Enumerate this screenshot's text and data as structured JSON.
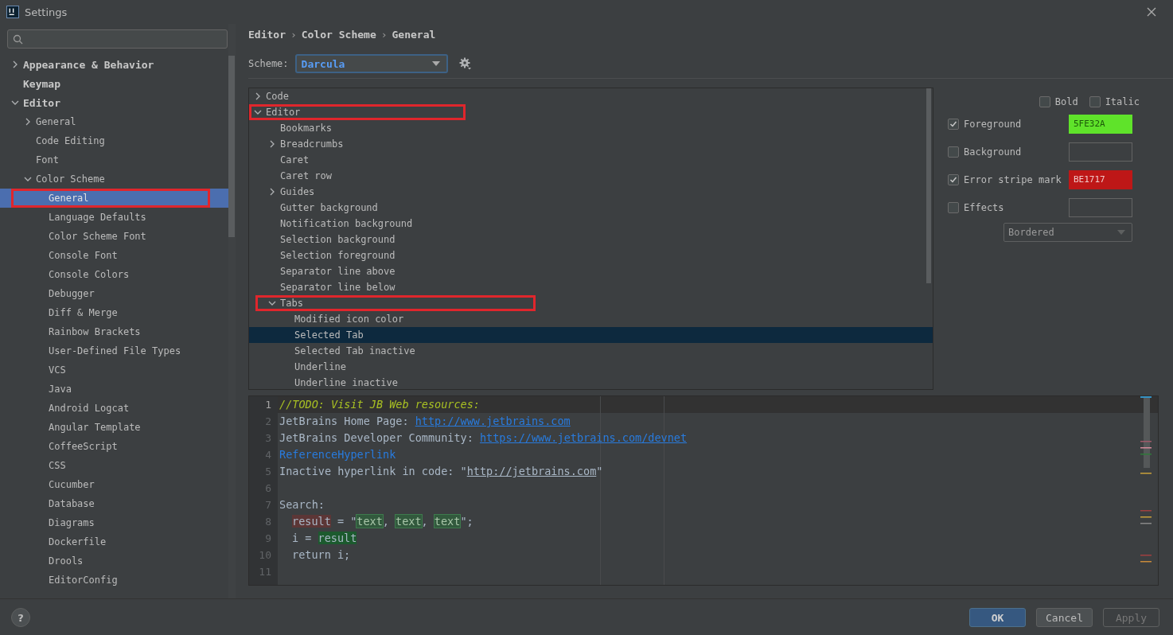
{
  "window": {
    "title": "Settings"
  },
  "sidebar": {
    "items": [
      {
        "label": "Appearance & Behavior",
        "expanded": false,
        "selected": false
      },
      {
        "label": "Keymap",
        "selected": false
      },
      {
        "label": "Editor",
        "expanded": true,
        "selected": false,
        "children": [
          {
            "label": "General",
            "expanded": false,
            "selected": false
          },
          {
            "label": "Code Editing",
            "selected": false
          },
          {
            "label": "Font",
            "selected": false
          },
          {
            "label": "Color Scheme",
            "expanded": true,
            "selected": false,
            "children": [
              {
                "label": "General",
                "selected": true,
                "annotated": true
              },
              {
                "label": "Language Defaults",
                "selected": false
              },
              {
                "label": "Color Scheme Font",
                "selected": false
              },
              {
                "label": "Console Font",
                "selected": false
              },
              {
                "label": "Console Colors",
                "selected": false
              },
              {
                "label": "Debugger",
                "selected": false
              },
              {
                "label": "Diff & Merge",
                "selected": false
              },
              {
                "label": "Rainbow Brackets",
                "selected": false
              },
              {
                "label": "User-Defined File Types",
                "selected": false
              },
              {
                "label": "VCS",
                "selected": false
              },
              {
                "label": "Java",
                "selected": false
              },
              {
                "label": "Android Logcat",
                "selected": false
              },
              {
                "label": "Angular Template",
                "selected": false
              },
              {
                "label": "CoffeeScript",
                "selected": false
              },
              {
                "label": "CSS",
                "selected": false
              },
              {
                "label": "Cucumber",
                "selected": false
              },
              {
                "label": "Database",
                "selected": false
              },
              {
                "label": "Diagrams",
                "selected": false
              },
              {
                "label": "Dockerfile",
                "selected": false
              },
              {
                "label": "Drools",
                "selected": false
              },
              {
                "label": "EditorConfig",
                "selected": false
              }
            ]
          }
        ]
      }
    ]
  },
  "breadcrumb": {
    "separator": "›",
    "items": [
      "Editor",
      "Color Scheme",
      "General"
    ]
  },
  "scheme": {
    "label": "Scheme:",
    "value": "Darcula"
  },
  "attributes": [
    {
      "label": "Code",
      "expanded": false,
      "selected": false
    },
    {
      "label": "Editor",
      "expanded": true,
      "selected": false,
      "annotated": true,
      "children": [
        {
          "label": "Bookmarks",
          "selected": false
        },
        {
          "label": "Breadcrumbs",
          "expanded": false,
          "selected": false
        },
        {
          "label": "Caret",
          "selected": false
        },
        {
          "label": "Caret row",
          "selected": false
        },
        {
          "label": "Guides",
          "expanded": false,
          "selected": false
        },
        {
          "label": "Gutter background",
          "selected": false
        },
        {
          "label": "Notification background",
          "selected": false
        },
        {
          "label": "Selection background",
          "selected": false
        },
        {
          "label": "Selection foreground",
          "selected": false
        },
        {
          "label": "Separator line above",
          "selected": false
        },
        {
          "label": "Separator line below",
          "selected": false
        },
        {
          "label": "Tabs",
          "expanded": true,
          "selected": false,
          "annotated": true,
          "children": [
            {
              "label": "Modified icon color",
              "selected": false
            },
            {
              "label": "Selected Tab",
              "selected": true
            },
            {
              "label": "Selected Tab inactive",
              "selected": false
            },
            {
              "label": "Underline",
              "selected": false
            },
            {
              "label": "Underline inactive",
              "selected": false
            }
          ]
        }
      ]
    }
  ],
  "style_options": [
    {
      "label": "Bold",
      "checked": false
    },
    {
      "label": "Italic",
      "checked": false
    }
  ],
  "color_options": [
    {
      "label": "Foreground",
      "checked": true,
      "value": "5FE32A",
      "color": "#5fe32a"
    },
    {
      "label": "Background",
      "checked": false
    },
    {
      "label": "Error stripe mark",
      "checked": true,
      "value": "BE1717",
      "color": "#be1717"
    },
    {
      "label": "Effects",
      "checked": false
    }
  ],
  "effect_type": {
    "value": "Bordered",
    "disabled": true
  },
  "preview": {
    "lines": [
      {
        "number": "1",
        "current": true,
        "tokens": [
          {
            "kind": "comment",
            "text": "//TODO: Visit JB Web resources:"
          }
        ]
      },
      {
        "number": "2",
        "current": false,
        "tokens": [
          {
            "kind": "plain",
            "text": "JetBrains Home Page: "
          },
          {
            "kind": "link",
            "text": "http://www.jetbrains.com"
          }
        ]
      },
      {
        "number": "3",
        "current": false,
        "tokens": [
          {
            "kind": "plain",
            "text": "JetBrains Developer Community: "
          },
          {
            "kind": "link",
            "text": "https://www.jetbrains.com/devnet"
          }
        ]
      },
      {
        "number": "4",
        "current": false,
        "tokens": [
          {
            "kind": "reference",
            "text": "ReferenceHyperlink"
          }
        ]
      },
      {
        "number": "5",
        "current": false,
        "tokens": [
          {
            "kind": "plain",
            "text": "Inactive hyperlink in code: \""
          },
          {
            "kind": "inactive_link",
            "text": "http://jetbrains.com"
          },
          {
            "kind": "plain",
            "text": "\""
          }
        ]
      },
      {
        "number": "6",
        "current": false
      },
      {
        "number": "7",
        "current": false,
        "tokens": [
          {
            "kind": "plain",
            "text": "Search:"
          }
        ]
      },
      {
        "number": "8",
        "current": false,
        "indented": true,
        "tokens": [
          {
            "kind": "write_usage",
            "text": "result"
          },
          {
            "kind": "plain",
            "text": " = \""
          },
          {
            "kind": "search_result",
            "text": "text"
          },
          {
            "kind": "plain",
            "text": ", "
          },
          {
            "kind": "search_result",
            "text": "text"
          },
          {
            "kind": "plain",
            "text": ", "
          },
          {
            "kind": "search_result",
            "text": "text"
          },
          {
            "kind": "plain",
            "text": "\";"
          }
        ]
      },
      {
        "number": "9",
        "current": false,
        "indented": true,
        "tokens": [
          {
            "kind": "plain",
            "text": "i = "
          },
          {
            "kind": "read_usage",
            "text": "result"
          }
        ]
      },
      {
        "number": "10",
        "current": false,
        "indented": true,
        "tokens": [
          {
            "kind": "plain",
            "text": "return i;"
          }
        ]
      },
      {
        "number": "11",
        "current": false
      }
    ]
  },
  "help_button": {
    "label": "?"
  },
  "buttons": [
    {
      "label": "OK",
      "kind": "primary",
      "disabled": false
    },
    {
      "label": "Cancel",
      "kind": "normal",
      "disabled": false
    },
    {
      "label": "Apply",
      "kind": "normal",
      "disabled": true
    }
  ]
}
